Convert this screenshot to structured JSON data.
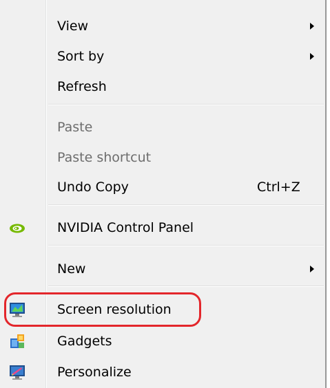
{
  "menu": {
    "items": [
      {
        "label": "View",
        "submenu": true
      },
      {
        "label": "Sort by",
        "submenu": true
      },
      {
        "label": "Refresh"
      },
      {
        "label": "Paste",
        "disabled": true
      },
      {
        "label": "Paste shortcut",
        "disabled": true
      },
      {
        "label": "Undo Copy",
        "shortcut": "Ctrl+Z"
      },
      {
        "label": "NVIDIA Control Panel",
        "icon": "nvidia-icon"
      },
      {
        "label": "New",
        "submenu": true
      },
      {
        "label": "Screen resolution",
        "icon": "monitor-icon"
      },
      {
        "label": "Gadgets",
        "icon": "gadgets-icon"
      },
      {
        "label": "Personalize",
        "icon": "personalize-icon"
      }
    ]
  },
  "annotation": {
    "highlight_color": "#e3262b"
  }
}
